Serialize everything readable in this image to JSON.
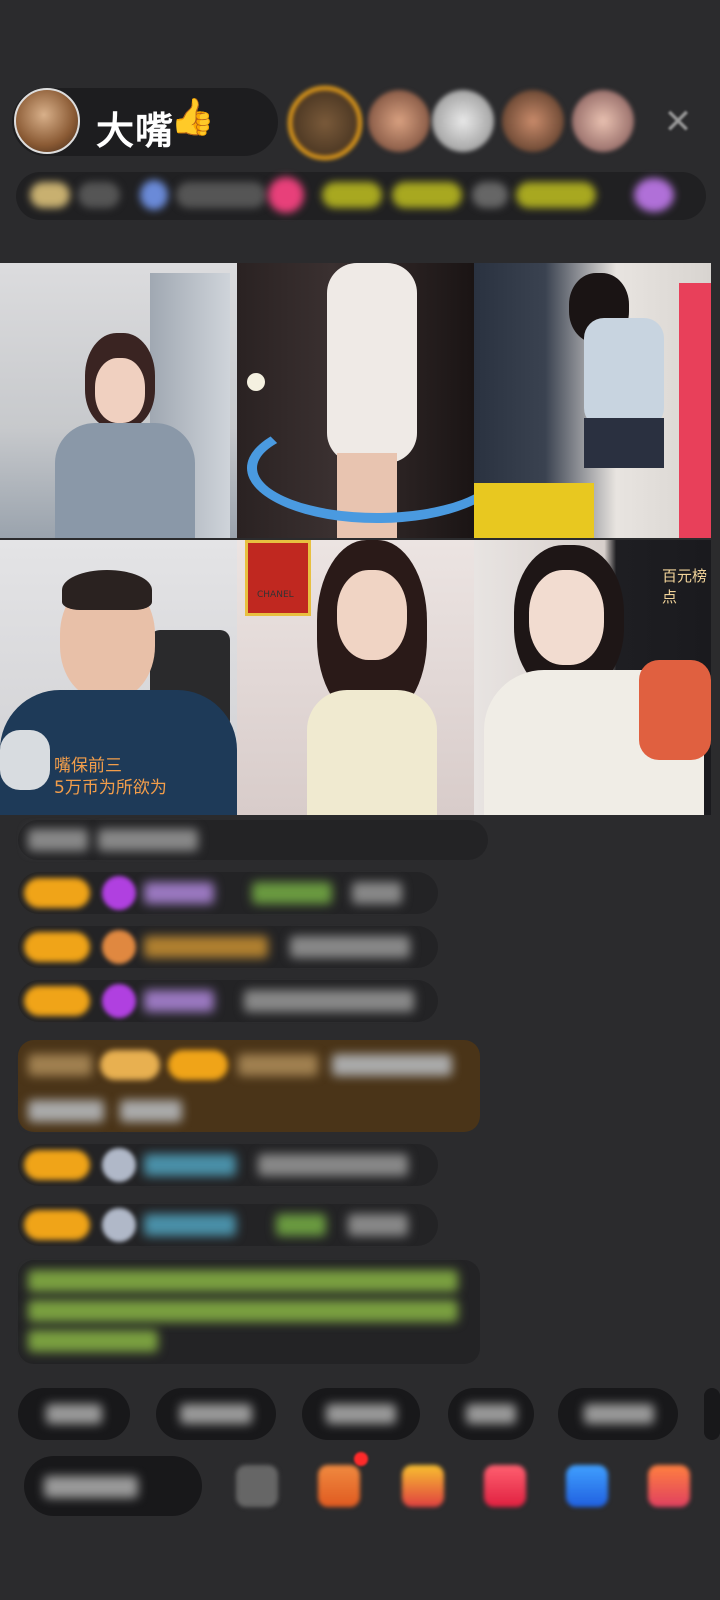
{
  "header": {
    "host_name": "大嘴",
    "thumb_emoji": "👍",
    "close_symbol": "✕"
  },
  "video_grid": {
    "caption_line1": "嘴保前三",
    "caption_line2": "5万币为所欲为",
    "corner_label": "百元榜点",
    "chanel_text": "CHANEL"
  },
  "colors": {
    "background": "#2b2b2d",
    "level_badge": "#f0a418",
    "caption": "#f29d4a",
    "green_text": "#9ccc4a"
  }
}
